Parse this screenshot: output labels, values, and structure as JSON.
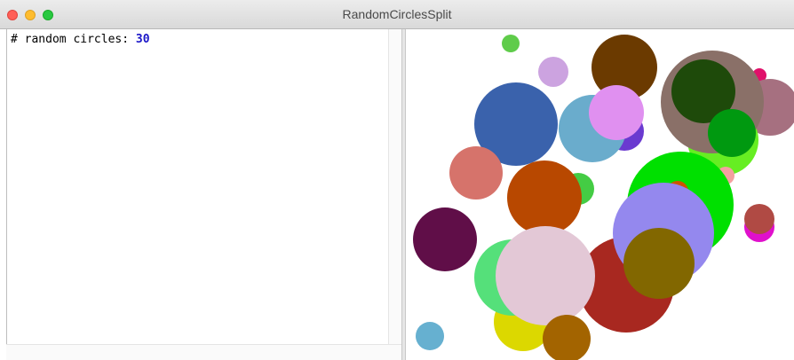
{
  "window": {
    "title": "RandomCirclesSplit"
  },
  "console": {
    "label": "# random circles: ",
    "value": "30"
  },
  "circles": [
    {
      "color": "#6b3a00"
    },
    {
      "color": "#cca3e0"
    },
    {
      "color": "#5fcc4a"
    },
    {
      "color": "#e0106a"
    },
    {
      "color": "#a67080"
    },
    {
      "color": "#66ee22"
    },
    {
      "color": "#8a7068"
    },
    {
      "color": "#1e4a0a"
    },
    {
      "color": "#009910"
    },
    {
      "color": "#f5a0a0"
    },
    {
      "color": "#6a3ad0"
    },
    {
      "color": "#6aaccc"
    },
    {
      "color": "#3a62ac"
    },
    {
      "color": "#e090f0"
    },
    {
      "color": "#d6736b"
    },
    {
      "color": "#44cc44"
    },
    {
      "color": "#b84800"
    },
    {
      "color": "#00e000"
    },
    {
      "color": "#cc5500"
    },
    {
      "color": "#e010cc"
    },
    {
      "color": "#b04a44"
    },
    {
      "color": "#600e48"
    },
    {
      "color": "#a82820"
    },
    {
      "color": "#9488ee"
    },
    {
      "color": "#826700"
    },
    {
      "color": "#dcd800"
    },
    {
      "color": "#55e07a"
    },
    {
      "color": "#e3c8d6"
    },
    {
      "color": "#a36400"
    },
    {
      "color": "#66b0d0"
    }
  ]
}
